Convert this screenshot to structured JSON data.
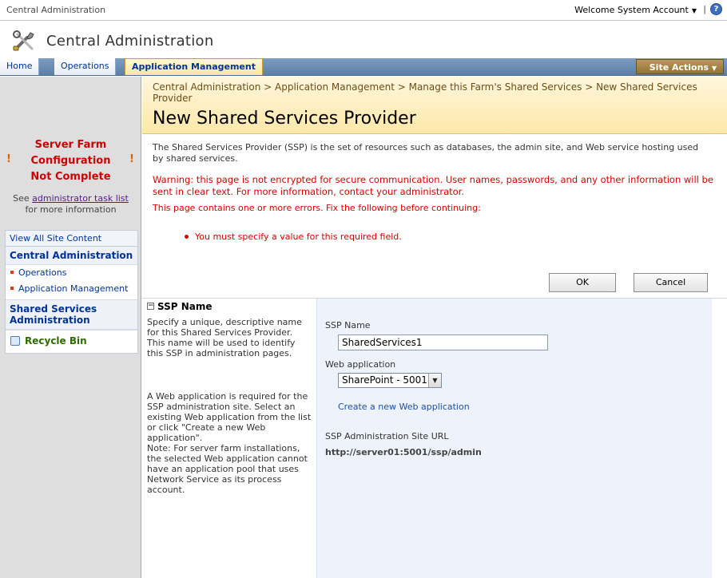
{
  "topbar": {
    "site_name": "Central Administration",
    "welcome": "Welcome System Account",
    "separator": "|",
    "help_glyph": "?"
  },
  "title_area": {
    "title": "Central Administration",
    "logo_icon": "tools-icon"
  },
  "tabs": {
    "home": "Home",
    "operations": "Operations",
    "application_management": "Application Management",
    "active": "Application Management"
  },
  "site_actions": {
    "label": "Site Actions",
    "caret": "▼"
  },
  "left_nav": {
    "farm_warning": {
      "line1": "Server Farm",
      "line2": "Configuration",
      "line3": "Not Complete",
      "alert_icon": "!"
    },
    "see_task": {
      "prefix": "See",
      "link": "administrator task list",
      "suffix": "for more information"
    },
    "quick_launch": {
      "view_all": "View All Site Content",
      "central_admin": "Central Administration",
      "items": [
        "Operations",
        "Application Management"
      ],
      "shared_services": "Shared Services Administration",
      "recycle_bin": "Recycle Bin"
    }
  },
  "main": {
    "breadcrumb": "Central Administration > Application Management > Manage this Farm's Shared Services > New Shared Services Provider",
    "page_title": "New Shared Services Provider",
    "description": "The Shared Services Provider (SSP) is the set of resources such as databases, the admin site, and Web service hosting used by shared services.",
    "warning": "Warning: this page is not encrypted for secure communication. User names, passwords, and any other information will be sent in clear text. For more information, contact your administrator.",
    "error_intro": "This page contains one or more errors. Fix the following before continuing:",
    "error_item": "You must specify a value for this required field.",
    "ok_button": "OK",
    "cancel_button": "Cancel"
  },
  "ssp_section": {
    "heading": "SSP Name",
    "collapse_glyph": "−",
    "help1": "Specify a unique, descriptive name for this Shared Services Provider. This name will be used to identify this SSP in administration pages.",
    "help2": "A Web application is required for the SSP administration site. Select an existing Web application from the list or click \"Create a new Web application\".",
    "help3": "Note: For server farm installations, the selected Web application cannot have an application pool that uses Network Service as its process account.",
    "ssp_name_label": "SSP Name",
    "ssp_name_value": "SharedServices1",
    "web_app_label": "Web application",
    "web_app_selected": "SharePoint - 5001",
    "create_web_app_link": "Create a new Web application",
    "site_url_label": "SSP Administration Site URL",
    "site_url_value": "http://server01:5001/ssp/admin"
  },
  "colors": {
    "tab_bar": "#6d8fb6",
    "title_banner": "#fde8a9",
    "error_red": "#d80000",
    "left_nav_bg": "#dedede",
    "form_bg": "#edf2fb",
    "site_actions": "#a58646"
  }
}
